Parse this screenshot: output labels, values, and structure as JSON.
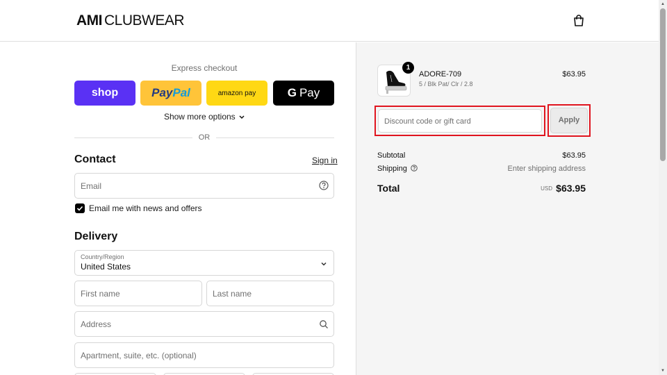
{
  "brand": {
    "logo_bold": "AMI",
    "logo_light": "CLUBWEAR"
  },
  "express": {
    "title": "Express checkout",
    "buttons": {
      "shop": "shop",
      "paypal_a": "Pay",
      "paypal_b": "Pal",
      "amazon": "amazon pay",
      "gpay_g": "G",
      "gpay": "Pay"
    },
    "more_options": "Show more options",
    "or": "OR"
  },
  "contact": {
    "heading": "Contact",
    "sign_in": "Sign in",
    "email_placeholder": "Email",
    "newsletter_label": "Email me with news and offers",
    "newsletter_checked": true
  },
  "delivery": {
    "heading": "Delivery",
    "country_label": "Country/Region",
    "country_value": "United States",
    "first_name": "First name",
    "last_name": "Last name",
    "address": "Address",
    "apartment": "Apartment, suite, etc. (optional)"
  },
  "order": {
    "item": {
      "name": "ADORE-709",
      "variant": "5 / Blk Pat/ Clr / 2.8",
      "price": "$63.95",
      "quantity": "1"
    },
    "discount_placeholder": "Discount code or gift card",
    "apply_label": "Apply",
    "subtotal_label": "Subtotal",
    "subtotal_value": "$63.95",
    "shipping_label": "Shipping",
    "shipping_value": "Enter shipping address",
    "total_label": "Total",
    "total_currency": "USD",
    "total_value": "$63.95"
  },
  "colors": {
    "shop": "#5a31f4",
    "paypal": "#ffc439",
    "amazon": "#ffd814",
    "gpay": "#000000",
    "highlight": "#e0141e"
  }
}
